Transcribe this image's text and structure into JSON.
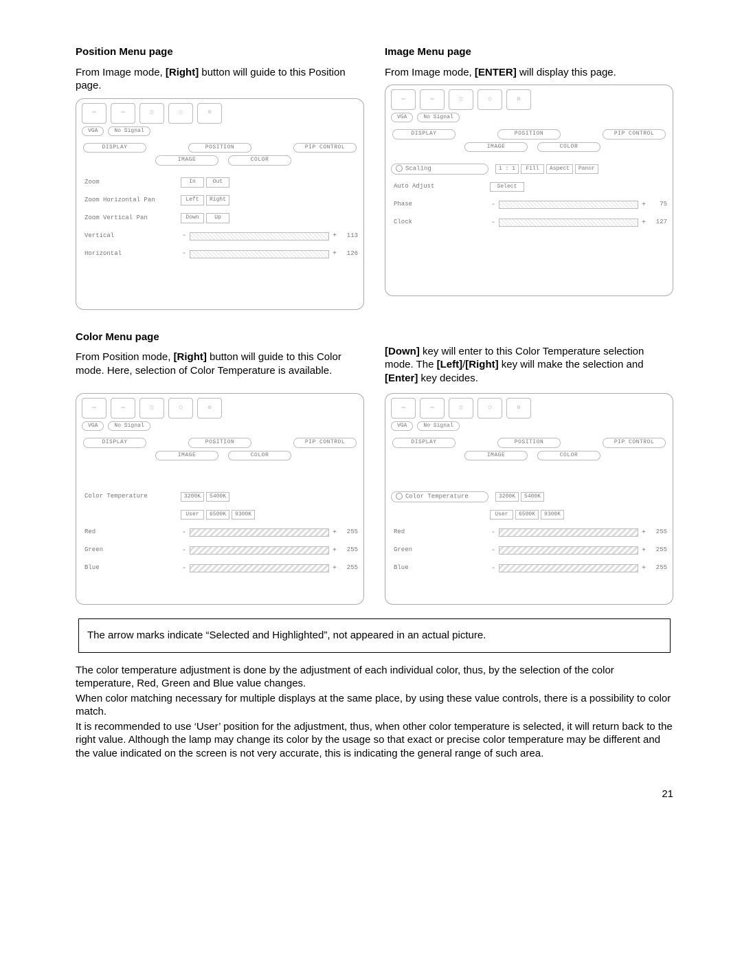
{
  "page_number": "21",
  "sections": {
    "position": {
      "title": "Position Menu page",
      "desc_pre": "From Image mode, ",
      "desc_bold": "[Right]",
      "desc_post": " button will guide to this Position page."
    },
    "image": {
      "title": "Image Menu page",
      "desc_pre": "From Image mode, ",
      "desc_bold": "[ENTER]",
      "desc_post": " will display this page."
    },
    "color": {
      "title": "Color Menu page",
      "desc_pre": "From Position mode, ",
      "desc_bold": "[Right]",
      "desc_post": " button will guide to this Color mode.   Here, selection of Color Temperature is available."
    },
    "color_right": {
      "line1_bold1": "[Down]",
      "line1_rest": " key will enter to this Color Temperature selection mode.   The ",
      "line1_bold2": "[Left]",
      "slash": "/",
      "line1_bold3": "[Right]",
      "line1_rest2": " key will make the selection and ",
      "line1_bold4": "[Enter]",
      "line1_rest3": " key decides."
    }
  },
  "osd_common": {
    "status_vga": "VGA",
    "status_nosignal": "No Signal",
    "tab_display": "DISPLAY",
    "tab_position": "POSITION",
    "tab_pip": "PIP CONTROL",
    "tab_image": "IMAGE",
    "tab_color": "COLOR"
  },
  "position_panel": {
    "rows": {
      "zoom": "Zoom",
      "zoom_btn_in": "In",
      "zoom_btn_out": "Out",
      "zhp": "Zoom Horizontal Pan",
      "zhp_left": "Left",
      "zhp_right": "Right",
      "zvp": "Zoom Vertical Pan",
      "zvp_down": "Down",
      "zvp_up": "Up",
      "vertical": "Vertical",
      "vertical_val": "113",
      "horizontal": "Horizontal",
      "horizontal_val": "126"
    }
  },
  "image_panel": {
    "rows": {
      "scaling": "Scaling",
      "scale_1_1": "1 : 1",
      "scale_fill": "Fill",
      "scale_aspect": "Aspect",
      "scale_panor": "Panor",
      "auto_adjust": "Auto Adjust",
      "auto_select": "Select",
      "phase": "Phase",
      "phase_val": "75",
      "clock": "Clock",
      "clock_val": "127"
    }
  },
  "color_panel": {
    "rows": {
      "colortemp": "Color Temperature",
      "ct_3200": "3200K",
      "ct_5400": "5400K",
      "ct_user": "User",
      "ct_6500": "6500K",
      "ct_9300": "9300K",
      "red": "Red",
      "red_val": "255",
      "green": "Green",
      "green_val": "255",
      "blue": "Blue",
      "blue_val": "255"
    }
  },
  "note_box": "The arrow marks indicate “Selected and Highlighted”, not appeared in an actual picture.",
  "body_text": {
    "p1": "The color temperature adjustment is done by the adjustment of each individual color, thus, by the selection of the color temperature, Red, Green and Blue value changes.",
    "p2": "When color matching necessary for multiple displays at the same place, by using these value controls, there is a possibility to color match.",
    "p3": "It is recommended to use ‘User’ position for the adjustment, thus, when other color temperature is selected, it will return back to the right value.   Although the lamp may change its color by the usage so that exact or precise color temperature may be different and the value indicated on the screen is not very accurate, this is indicating the general range of such area."
  }
}
